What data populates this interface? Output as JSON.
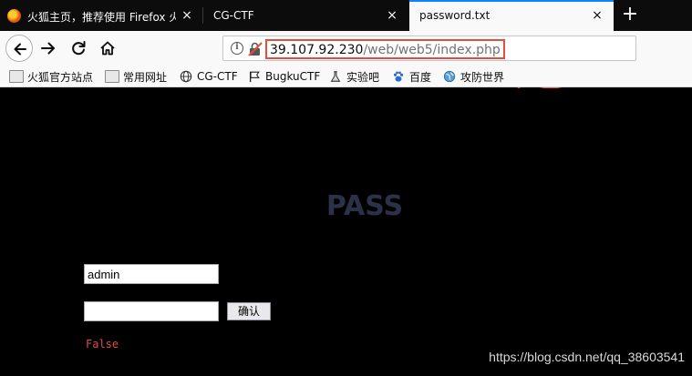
{
  "tabs": [
    {
      "title": "火狐主页，推荐使用 Firefox 火",
      "close": "×"
    },
    {
      "title": "CG-CTF",
      "close": "×"
    },
    {
      "title": "password.txt",
      "close": "×"
    }
  ],
  "new_tab": "+",
  "nav": {
    "info": "i",
    "url_host": "39.107.92.230",
    "url_path": "/web/web5/index.php"
  },
  "bookmarks": [
    {
      "label": "火狐官方站点",
      "icon": "folder-icon"
    },
    {
      "label": "常用网址",
      "icon": "folder-icon"
    },
    {
      "label": "CG-CTF",
      "icon": "globe-icon"
    },
    {
      "label": "BugkuCTF",
      "icon": "flag-icon"
    },
    {
      "label": "实验吧",
      "icon": "lab-icon"
    },
    {
      "label": "百度",
      "icon": "baidu-paw-icon"
    },
    {
      "label": "攻防世界",
      "icon": "world-icon"
    }
  ],
  "page": {
    "title": "PASS",
    "username_value": "admin",
    "password_value": "",
    "confirm_label": "确认",
    "result": "False",
    "watermark": "https://blog.csdn.net/qq_38603541"
  },
  "colors": {
    "accent_tab": "#0a84ff",
    "highlight": "#e74c3c",
    "title": "#2b3248"
  }
}
